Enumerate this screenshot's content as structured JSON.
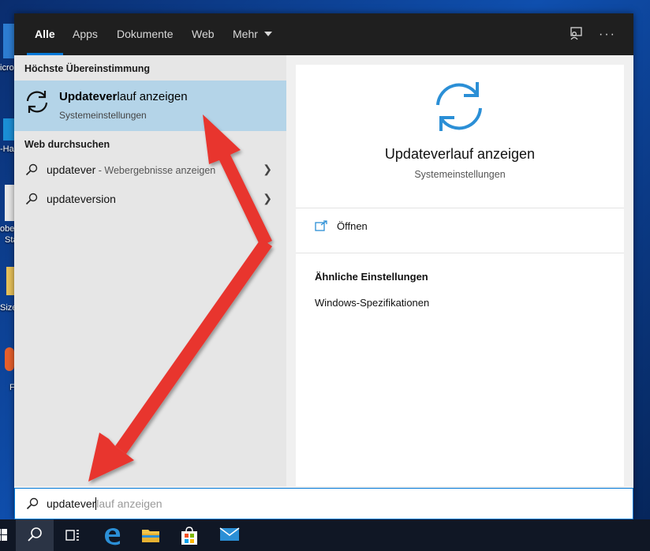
{
  "desktop": {
    "labels": [
      "icro",
      "-Ha",
      "obe",
      "Sta",
      "Size",
      "F"
    ]
  },
  "tabs": [
    {
      "label": "Alle",
      "active": true
    },
    {
      "label": "Apps"
    },
    {
      "label": "Dokumente"
    },
    {
      "label": "Web"
    },
    {
      "label": "Mehr"
    }
  ],
  "topbar_icons": [
    "feedback-icon",
    "more-options-icon"
  ],
  "left": {
    "best_match_title": "Höchste Übereinstimmung",
    "best_match": {
      "title_bold": "Updatever",
      "title_rest": "lauf anzeigen",
      "subtitle": "Systemeinstellungen"
    },
    "web_title": "Web durchsuchen",
    "web_results": [
      {
        "query": "updatever",
        "hint": " - Webergebnisse anzeigen"
      },
      {
        "query": "updateversion",
        "hint": ""
      }
    ]
  },
  "right": {
    "title": "Updateverlauf anzeigen",
    "subtitle": "Systemeinstellungen",
    "open_label": "Öffnen",
    "similar_title": "Ähnliche Einstellungen",
    "similar_items": [
      "Windows-Spezifikationen"
    ]
  },
  "search": {
    "typed": "updatever",
    "completion": "lauf anzeigen"
  },
  "colors": {
    "accent": "#0078d7",
    "selection": "#b4d4e8",
    "topbar": "#1f1f1f",
    "arrow": "#e8342f"
  }
}
